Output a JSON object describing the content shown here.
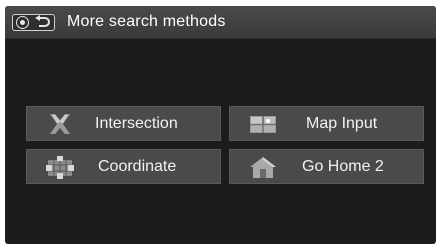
{
  "header": {
    "back_icon": "home-back-icon",
    "title": "More search methods"
  },
  "menu": {
    "items": [
      {
        "label": "Intersection",
        "icon": "intersection-icon"
      },
      {
        "label": "Map Input",
        "icon": "map-icon"
      },
      {
        "label": "Coordinate",
        "icon": "compass-grid-icon"
      },
      {
        "label": "Go Home 2",
        "icon": "house-icon"
      }
    ]
  }
}
